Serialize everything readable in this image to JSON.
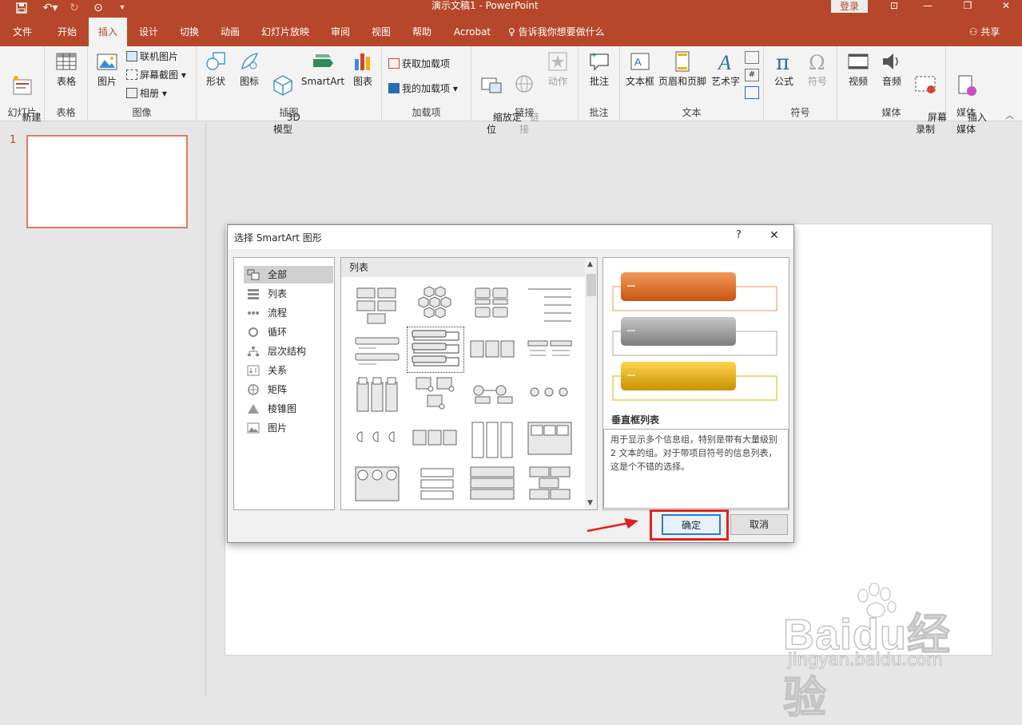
{
  "window": {
    "title": "演示文稿1 - PowerPoint",
    "login_label": "登录",
    "share_label": "共享",
    "tell_me": "告诉我你想要做什么"
  },
  "tabs": [
    "文件",
    "开始",
    "插入",
    "设计",
    "切换",
    "动画",
    "幻灯片放映",
    "审阅",
    "视图",
    "帮助",
    "Acrobat"
  ],
  "ribbon": {
    "groups": {
      "slides": "幻灯片",
      "tables": "表格",
      "images": "图像",
      "illustrations": "插图",
      "addins": "加载项",
      "links": "链接",
      "comments": "批注",
      "text": "文本",
      "symbols": "符号",
      "media": "媒体",
      "media2": "媒体"
    },
    "new_slide": "新建\n幻灯片",
    "table": "表格",
    "picture": "图片",
    "online_picture": "联机图片",
    "screenshot": "屏幕截图",
    "album": "相册",
    "shapes": "形状",
    "icons": "图标",
    "model3d": "3D\n模型",
    "smartart": "SmartArt",
    "chart": "图表",
    "get_addins": "获取加载项",
    "my_addins": "我的加载项",
    "zoom": "缩放定\n位",
    "link": "链\n接",
    "action": "动作",
    "comment": "批注",
    "textbox": "文本框",
    "header_footer": "页眉和页脚",
    "wordart": "艺术字",
    "equation": "公式",
    "symbol": "符号",
    "video": "视频",
    "audio": "音频",
    "screen_record": "屏幕\n录制",
    "insert_media": "插入\n媒体"
  },
  "slide_panel": {
    "slide_number": "1"
  },
  "dialog": {
    "title": "选择 SmartArt 图形",
    "help": "?",
    "close": "✕",
    "categories": [
      "全部",
      "列表",
      "流程",
      "循环",
      "层次结构",
      "关系",
      "矩阵",
      "棱锥图",
      "图片"
    ],
    "selected_category": "全部",
    "gallery_header": "列表",
    "preview_title": "垂直框列表",
    "preview_desc": "用于显示多个信息组，特别是带有大量级别 2 文本的组。对于带项目符号的信息列表，这是个不错的选择。",
    "ok": "确定",
    "cancel": "取消"
  },
  "watermark": {
    "brand": "Baidu经验",
    "url": "jingyan.baidu.com"
  },
  "colors": {
    "accent": "#b7472a",
    "ok_highlight": "#e02020"
  }
}
